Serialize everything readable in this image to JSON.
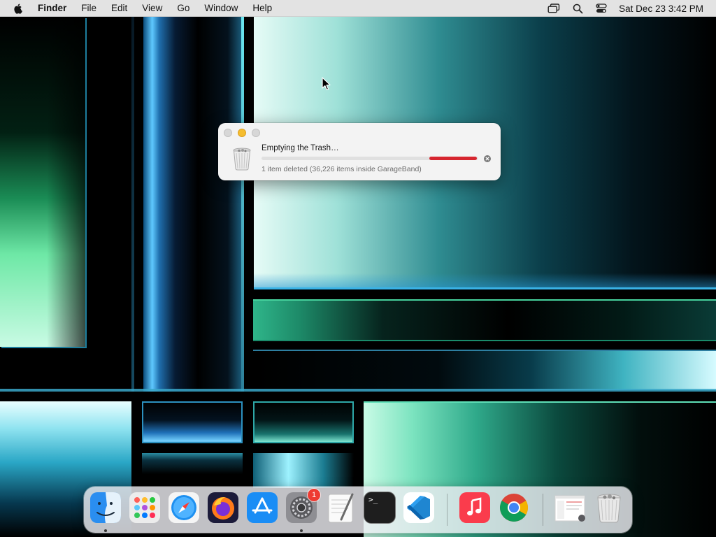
{
  "menubar": {
    "app_name": "Finder",
    "menus": [
      "File",
      "Edit",
      "View",
      "Go",
      "Window",
      "Help"
    ],
    "clock": "Sat Dec 23  3:42 PM",
    "status_icons": [
      "screen-mirroring-icon",
      "spotlight-search-icon",
      "control-center-icon"
    ]
  },
  "dialog": {
    "title": "Emptying the Trash…",
    "status": "1 item deleted (36,226 items inside GarageBand)",
    "progress_color": "#d6262f"
  },
  "dock": {
    "items": [
      {
        "name": "finder",
        "running": true
      },
      {
        "name": "launchpad",
        "running": false
      },
      {
        "name": "safari",
        "running": false
      },
      {
        "name": "firefox",
        "running": false
      },
      {
        "name": "app-store",
        "running": false
      },
      {
        "name": "system-settings",
        "running": true,
        "badge": "1"
      },
      {
        "name": "textedit",
        "running": false
      },
      {
        "name": "terminal",
        "running": false
      },
      {
        "name": "vscode",
        "running": false
      },
      {
        "name": "music",
        "running": false
      },
      {
        "name": "chrome",
        "running": false
      },
      {
        "name": "downloads-stack",
        "running": false
      },
      {
        "name": "trash",
        "running": false
      }
    ],
    "terminal_prompt": ">_"
  },
  "colors": {
    "menubar_bg": "#e3e3e3",
    "dialog_bg": "#f3f3f3",
    "minimize_yellow": "#f5bd2f",
    "badge_red": "#ee3b32"
  }
}
